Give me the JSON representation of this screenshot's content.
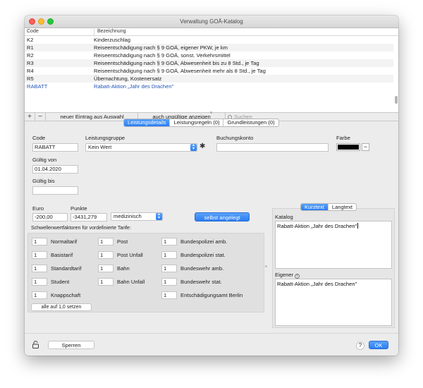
{
  "window": {
    "title": "Verwaltung GOÄ-Katalog"
  },
  "table": {
    "headers": {
      "code": "Code",
      "bezeichnung": "Bezeichnung"
    },
    "rows": [
      {
        "code": "K2",
        "text": "Kinderzuschlag"
      },
      {
        "code": "R1",
        "text": "Reiseentschädigung nach § 9 GOÄ, eigener PKW, je km"
      },
      {
        "code": "R2",
        "text": "Reiseentschädigung nach § 9 GOÄ, sonst. Verkehrsmittel"
      },
      {
        "code": "R3",
        "text": "Reiseentschädigung nach § 9 GOÄ, Abwesenheit bis zu 8 Std., je Tag"
      },
      {
        "code": "R4",
        "text": "Reiseentschädigung nach § 9 GOÄ, Abwesenheit mehr als 8 Std., je Tag"
      },
      {
        "code": "R5",
        "text": "Übernachtung, Kostenersatz"
      },
      {
        "code": "RABATT",
        "text": "Rabatt-Aktion „Jahr des Drachen\""
      }
    ]
  },
  "toolbar": {
    "add": "+",
    "remove": "−",
    "new_from_selection": "neuer Eintrag aus Auswahl",
    "show_invalid": "auch ungültige anzeigen",
    "search_placeholder": "Suchen"
  },
  "tabs": [
    "Leistungsdetails",
    "Leistungsregeln (0)",
    "Grundleistungen (0)"
  ],
  "form": {
    "code_label": "Code",
    "code_value": "RABATT",
    "gruppe_label": "Leistungsgruppe",
    "gruppe_value": "Kein Wert",
    "konto_label": "Buchungskonto",
    "konto_value": "",
    "farbe_label": "Farbe",
    "farbe_value": "#000000",
    "gueltig_von_label": "Gültig von",
    "gueltig_von_value": "01.04.2020",
    "gueltig_bis_label": "Gültig bis",
    "gueltig_bis_value": "",
    "euro_label": "Euro",
    "euro_value": "-200,00",
    "punkte_label": "Punkte",
    "punkte_value": "-3431,279",
    "typ_value": "medizinisch",
    "self_created": "selbst angelegt"
  },
  "tarife": {
    "heading": "Schwellenwertfaktoren für vordefinierte Tarife:",
    "col1": [
      {
        "value": "1",
        "label": "Normaltarif"
      },
      {
        "value": "1",
        "label": "Basistarif"
      },
      {
        "value": "1",
        "label": "Standardtarif"
      },
      {
        "value": "1",
        "label": "Student"
      },
      {
        "value": "1",
        "label": "Knappschaft"
      }
    ],
    "col2": [
      {
        "value": "1",
        "label": "Post"
      },
      {
        "value": "1",
        "label": "Post Unfall"
      },
      {
        "value": "1",
        "label": "Bahn"
      },
      {
        "value": "1",
        "label": "Bahn Unfall"
      }
    ],
    "col3": [
      {
        "value": "1",
        "label": "Bundespolizei amb."
      },
      {
        "value": "1",
        "label": "Bundespolizei stat."
      },
      {
        "value": "1",
        "label": "Bundeswehr amb."
      },
      {
        "value": "1",
        "label": "Bundeswehr stat."
      },
      {
        "value": "1",
        "label": "Entschädigungsamt Berlin"
      }
    ],
    "reset_all": "alle auf 1,0 setzen"
  },
  "texts": {
    "seg": [
      "Kurztext",
      "Langtext"
    ],
    "katalog_label": "Katalog",
    "katalog_value": "Rabatt-Aktion „Jahr des Drachen\"",
    "eigener_label": "Eigener",
    "eigener_value": "Rabatt-Aktion „Jahr des Drachen\""
  },
  "bottom": {
    "sperren": "Sperren",
    "help": "?",
    "ok": "OK"
  },
  "colors": {
    "accent": "#2c7ef2",
    "selected_text": "#2256b8"
  }
}
